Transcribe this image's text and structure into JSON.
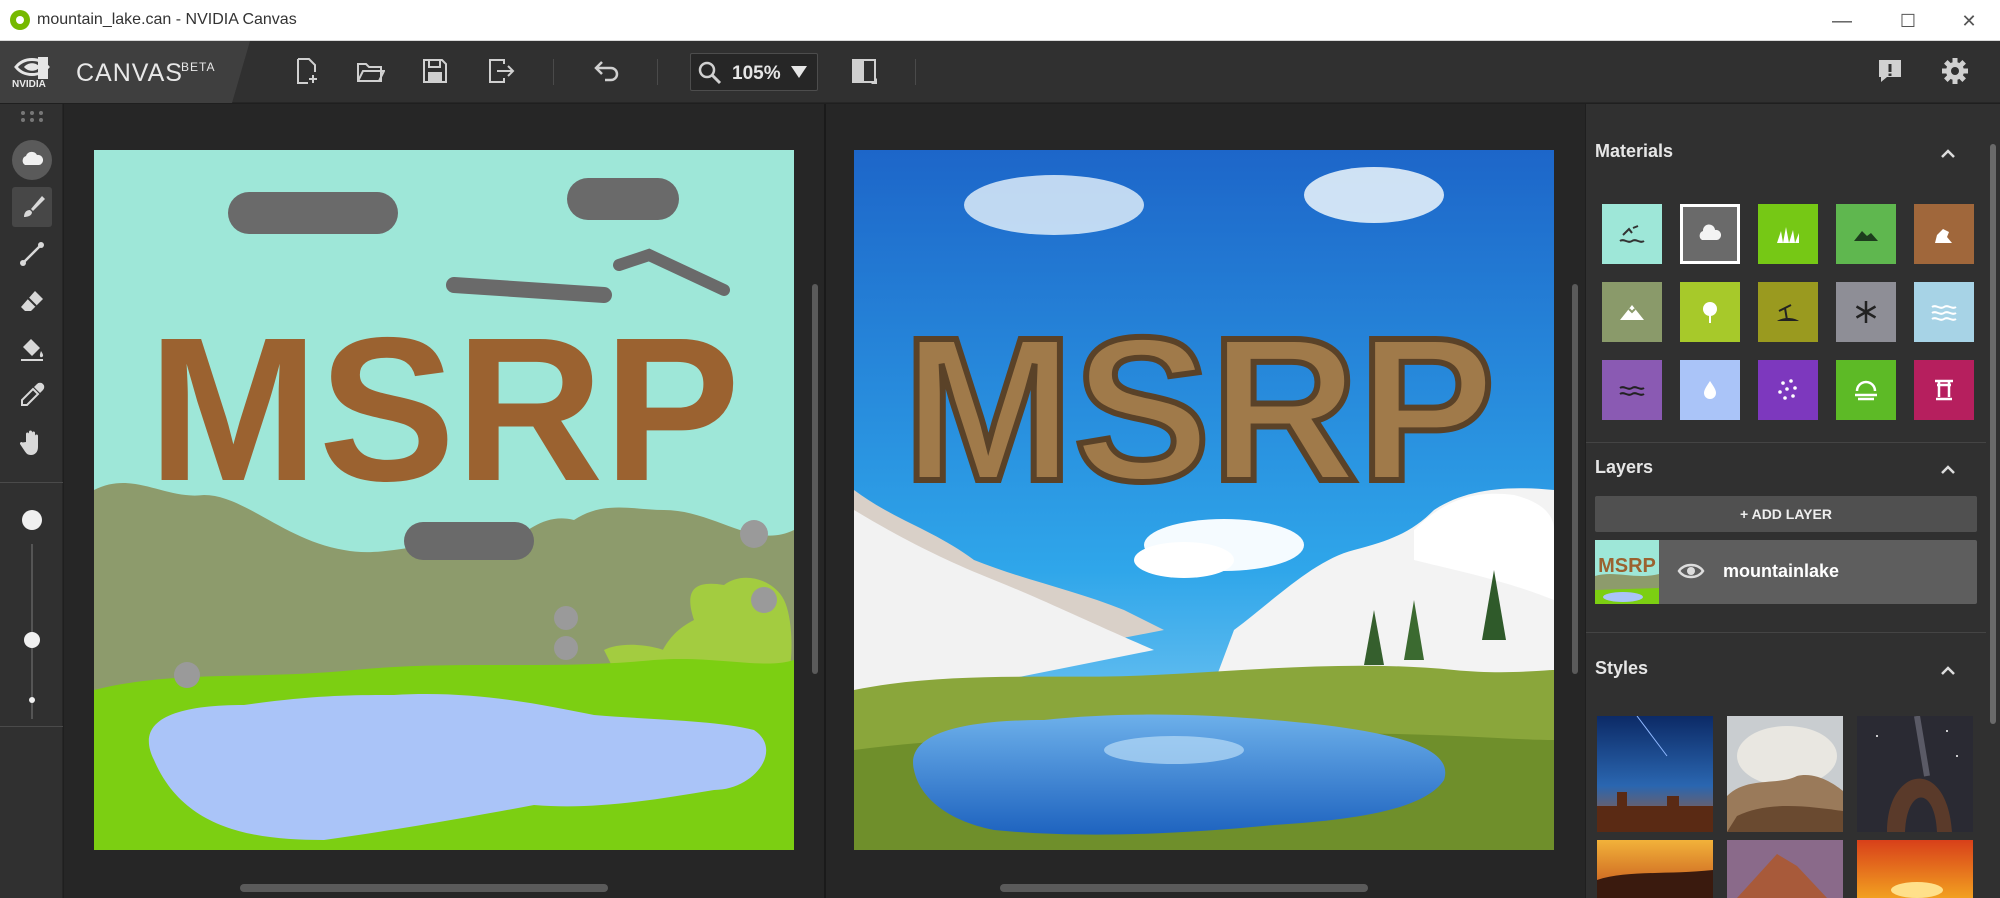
{
  "window": {
    "title": "mountain_lake.can - NVIDIA Canvas",
    "controls": {
      "minimize": "—",
      "maximize": "☐",
      "close": "✕"
    }
  },
  "brand": {
    "logo_text": "NVIDIA",
    "name": "CANVAS",
    "badge": "BETA"
  },
  "toolbar": {
    "buttons": [
      "new-file-icon",
      "open-folder-icon",
      "save-icon",
      "export-icon",
      "undo-icon",
      "compare-icon",
      "feedback-icon",
      "settings-icon"
    ],
    "zoom": "105%"
  },
  "tools": [
    "cloud-material-icon",
    "brush-icon",
    "line-icon",
    "eraser-icon",
    "fill-bucket-icon",
    "eyedropper-icon",
    "pan-hand-icon",
    "brush-size-large-icon",
    "brush-size-slider",
    "brush-size-small-icon"
  ],
  "canvas": {
    "sketch_text": "MSRP",
    "colors": {
      "sky": "#9ee7d8",
      "rock": "#9b6230",
      "cloud": "#6a6a6a",
      "hills": "#8d9b6c",
      "grass": "#7ccf12",
      "water": "#aac4f8",
      "bush": "#a3cc40"
    }
  },
  "materials": {
    "title": "Materials",
    "items": [
      {
        "name": "sea-icon",
        "color": "#9ee7d8"
      },
      {
        "name": "cloud-icon",
        "color": "#6a6a6a",
        "selected": true
      },
      {
        "name": "grass-icon",
        "color": "#76c815"
      },
      {
        "name": "hill-icon",
        "color": "#5fb74f"
      },
      {
        "name": "rock-icon",
        "color": "#a0673b"
      },
      {
        "name": "mountain-icon",
        "color": "#8a9a6a"
      },
      {
        "name": "tree-icon",
        "color": "#a7c92a"
      },
      {
        "name": "sand-icon",
        "color": "#9a9a1f"
      },
      {
        "name": "snow-icon",
        "color": "#8e8e96"
      },
      {
        "name": "river-icon",
        "color": "#a7d3e6"
      },
      {
        "name": "water-icon",
        "color": "#8a5ab3"
      },
      {
        "name": "drop-icon",
        "color": "#aac4f8"
      },
      {
        "name": "dust-icon",
        "color": "#7d38be"
      },
      {
        "name": "fog-icon",
        "color": "#5dba26"
      },
      {
        "name": "building-icon",
        "color": "#b61f5e"
      }
    ]
  },
  "layers": {
    "title": "Layers",
    "add_label": "+ ADD LAYER",
    "items": [
      {
        "name": "mountainlake",
        "thumb_text": "MSRP"
      }
    ]
  },
  "styles": {
    "title": "Styles"
  }
}
